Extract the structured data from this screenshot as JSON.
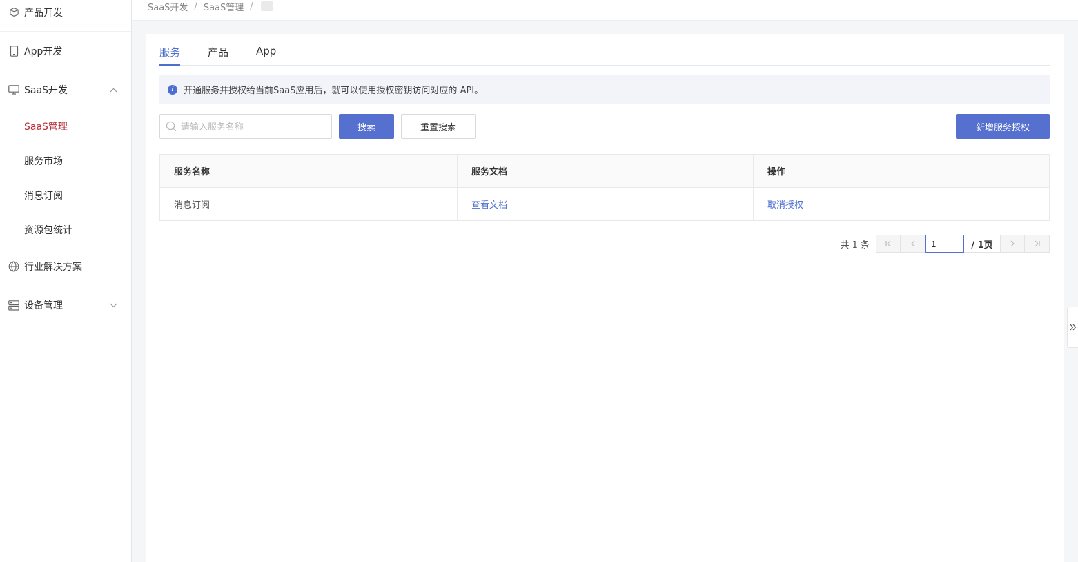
{
  "sidebar": {
    "items": [
      {
        "label": "产品开发",
        "icon": "cube-icon"
      },
      {
        "label": "App开发",
        "icon": "phone-icon"
      },
      {
        "label": "SaaS开发",
        "icon": "monitor-icon",
        "expanded": true,
        "children": [
          {
            "label": "SaaS管理",
            "active": true
          },
          {
            "label": "服务市场"
          },
          {
            "label": "消息订阅"
          },
          {
            "label": "资源包统计"
          }
        ]
      },
      {
        "label": "行业解决方案",
        "icon": "globe-icon"
      },
      {
        "label": "设备管理",
        "icon": "server-icon",
        "expanded": false
      }
    ]
  },
  "breadcrumb": [
    "SaaS开发",
    "SaaS管理"
  ],
  "breadcrumb_sep": "/",
  "tabs": [
    {
      "label": "服务",
      "active": true
    },
    {
      "label": "产品"
    },
    {
      "label": "App"
    }
  ],
  "notice": {
    "text": "开通服务并授权给当前SaaS应用后，就可以使用授权密钥访问对应的 API。"
  },
  "search": {
    "placeholder": "请输入服务名称",
    "value": ""
  },
  "buttons": {
    "search": "搜索",
    "reset": "重置搜索",
    "add": "新增服务授权"
  },
  "table": {
    "headers": [
      "服务名称",
      "服务文档",
      "操作"
    ],
    "rows": [
      {
        "name": "消息订阅",
        "doc": "查看文档",
        "action": "取消授权"
      }
    ]
  },
  "pagination": {
    "total": "共 1 条",
    "current": "1",
    "of": "/ 1页"
  },
  "colors": {
    "primary": "#5570cf",
    "active_menu": "#b8303a",
    "link": "#4d6fcf"
  }
}
